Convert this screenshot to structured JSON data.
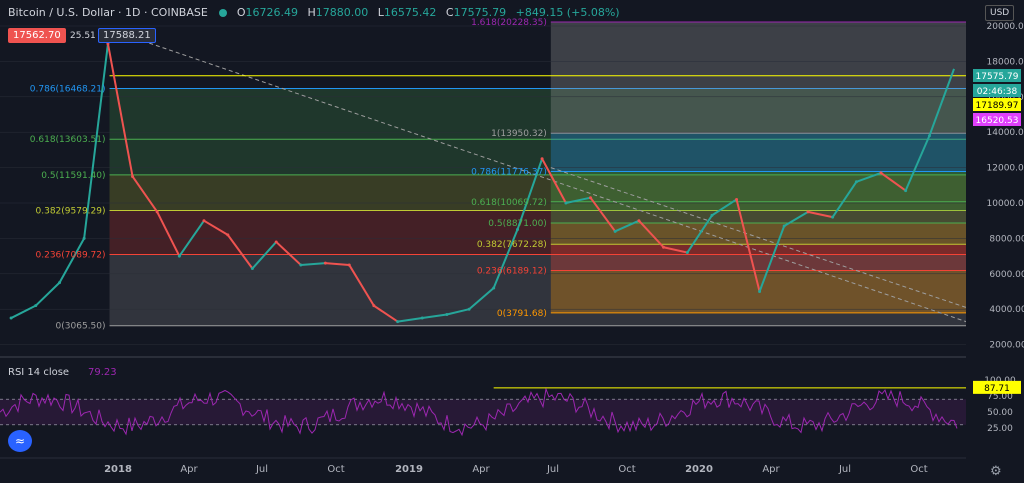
{
  "header": {
    "symbol": "Bitcoin / U.S. Dollar",
    "interval": "1D",
    "exchange": "COINBASE",
    "open_label": "O",
    "open": "16726.49",
    "high_label": "H",
    "high": "17880.00",
    "low_label": "L",
    "low": "16575.42",
    "close_label": "C",
    "close": "17575.79",
    "change": "+849.15 (+5.08%)"
  },
  "badges": {
    "left_price": "17562.70",
    "left_small": "25.51",
    "left_price2": "17588.21",
    "currency": "USD"
  },
  "colors": {
    "bg": "#131722",
    "up": "#26a69a",
    "down": "#ef5350",
    "rsi": "#9c27b0",
    "grid": "#2a2e39",
    "axis_text": "#b2b5be"
  },
  "price_axis": {
    "ticks": [
      "20000.00",
      "18000.00",
      "16000.00",
      "14000.00",
      "12000.00",
      "10000.00",
      "8000.00",
      "6000.00",
      "4000.00",
      "2000.00"
    ],
    "labels": [
      {
        "text": "17575.79",
        "bg": "#26a69a",
        "fg": "#ffffff"
      },
      {
        "text": "02:46:38",
        "bg": "#26a69a",
        "fg": "#ffffff"
      },
      {
        "text": "17189.97",
        "bg": "#ffff00",
        "fg": "#000000"
      },
      {
        "text": "16520.53",
        "bg": "#e040fb",
        "fg": "#ffffff"
      }
    ]
  },
  "rsi": {
    "title": "RSI 14 close",
    "value": "79.23",
    "ticks": [
      "100.00",
      "75.00",
      "50.00",
      "25.00"
    ],
    "marker": "87.71"
  },
  "time_axis": {
    "labels": [
      "2018",
      "Apr",
      "Jul",
      "Oct",
      "2019",
      "Apr",
      "Jul",
      "Oct",
      "2020",
      "Apr",
      "Jul",
      "Oct"
    ]
  },
  "chart_data": {
    "type": "line",
    "title": "Bitcoin / U.S. Dollar",
    "x_range": [
      "2017-08",
      "2020-11"
    ],
    "ylim": [
      1500,
      22000
    ],
    "price_path": [
      {
        "x": "2017-08",
        "y": 3500
      },
      {
        "x": "2017-09",
        "y": 4200
      },
      {
        "x": "2017-10",
        "y": 5500
      },
      {
        "x": "2017-11",
        "y": 8000
      },
      {
        "x": "2017-12",
        "y": 19000
      },
      {
        "x": "2018-01",
        "y": 11500
      },
      {
        "x": "2018-02",
        "y": 9500
      },
      {
        "x": "2018-03",
        "y": 7000
      },
      {
        "x": "2018-04",
        "y": 9000
      },
      {
        "x": "2018-05",
        "y": 8200
      },
      {
        "x": "2018-06",
        "y": 6300
      },
      {
        "x": "2018-07",
        "y": 7800
      },
      {
        "x": "2018-08",
        "y": 6500
      },
      {
        "x": "2018-09",
        "y": 6600
      },
      {
        "x": "2018-10",
        "y": 6500
      },
      {
        "x": "2018-11",
        "y": 4200
      },
      {
        "x": "2018-12",
        "y": 3300
      },
      {
        "x": "2019-01",
        "y": 3500
      },
      {
        "x": "2019-02",
        "y": 3700
      },
      {
        "x": "2019-03",
        "y": 4000
      },
      {
        "x": "2019-04",
        "y": 5200
      },
      {
        "x": "2019-05",
        "y": 8500
      },
      {
        "x": "2019-06",
        "y": 12500
      },
      {
        "x": "2019-07",
        "y": 10000
      },
      {
        "x": "2019-08",
        "y": 10300
      },
      {
        "x": "2019-09",
        "y": 8400
      },
      {
        "x": "2019-10",
        "y": 9000
      },
      {
        "x": "2019-11",
        "y": 7500
      },
      {
        "x": "2019-12",
        "y": 7200
      },
      {
        "x": "2020-01",
        "y": 9300
      },
      {
        "x": "2020-02",
        "y": 10200
      },
      {
        "x": "2020-03",
        "y": 5000
      },
      {
        "x": "2020-04",
        "y": 8700
      },
      {
        "x": "2020-05",
        "y": 9500
      },
      {
        "x": "2020-06",
        "y": 9200
      },
      {
        "x": "2020-07",
        "y": 11200
      },
      {
        "x": "2020-08",
        "y": 11700
      },
      {
        "x": "2020-09",
        "y": 10700
      },
      {
        "x": "2020-10",
        "y": 13800
      },
      {
        "x": "2020-11",
        "y": 17576
      }
    ],
    "fib_left": {
      "from": "2017-12-17",
      "to": "2020-11",
      "levels": [
        {
          "label": "0.786(16468.21)",
          "price": 16468.21,
          "color": "#2196f3"
        },
        {
          "label": "0.618(13603.51)",
          "price": 13603.51,
          "color": "#4caf50"
        },
        {
          "label": "0.5(11591.40)",
          "price": 11591.4,
          "color": "#4caf50"
        },
        {
          "label": "0.382(9579.29)",
          "price": 9579.29,
          "color": "#c0ca33"
        },
        {
          "label": "0.236(7089.72)",
          "price": 7089.72,
          "color": "#f44336"
        },
        {
          "label": "0(3065.50)",
          "price": 3065.5,
          "color": "#9e9e9e"
        }
      ]
    },
    "fib_right": {
      "from": "2019-06-26",
      "to": "2020-11",
      "levels": [
        {
          "label": "1.618(20228.35)",
          "price": 20228.35,
          "color": "#9c27b0"
        },
        {
          "label": "1(13950.32)",
          "price": 13950.32,
          "color": "#9e9e9e"
        },
        {
          "label": "0.786(11776.37)",
          "price": 11776.37,
          "color": "#2196f3"
        },
        {
          "label": "0.618(10069.72)",
          "price": 10069.72,
          "color": "#4caf50"
        },
        {
          "label": "0.5(8871.00)",
          "price": 8871.0,
          "color": "#4caf50"
        },
        {
          "label": "0.382(7672.28)",
          "price": 7672.28,
          "color": "#c0ca33"
        },
        {
          "label": "0.236(6189.12)",
          "price": 6189.12,
          "color": "#f44336"
        },
        {
          "label": "0(3791.68)",
          "price": 3791.68,
          "color": "#ff9800"
        }
      ]
    },
    "horizontal_line": 17189.97
  }
}
